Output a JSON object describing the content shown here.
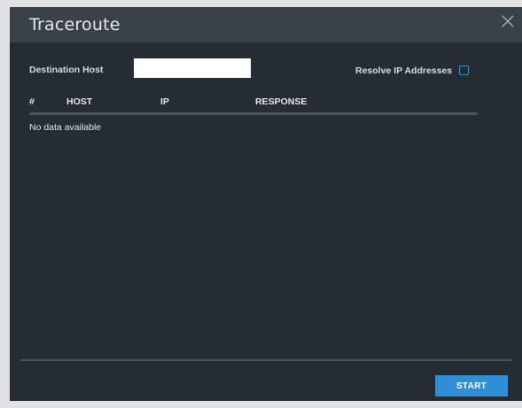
{
  "dialog": {
    "title": "Traceroute",
    "close_icon": "close-icon"
  },
  "form": {
    "destination_label": "Destination Host",
    "destination_value": "",
    "destination_placeholder": "",
    "resolve_label": "Resolve IP Addresses",
    "resolve_checked": false
  },
  "table": {
    "columns": [
      "#",
      "HOST",
      "IP",
      "RESPONSE"
    ],
    "rows": [],
    "empty_message": "No data available"
  },
  "footer": {
    "start_label": "START"
  },
  "colors": {
    "dialog_bg": "#262c33",
    "titlebar_bg": "#3a4149",
    "accent": "#2f8ed8",
    "divider": "#4a525b"
  }
}
